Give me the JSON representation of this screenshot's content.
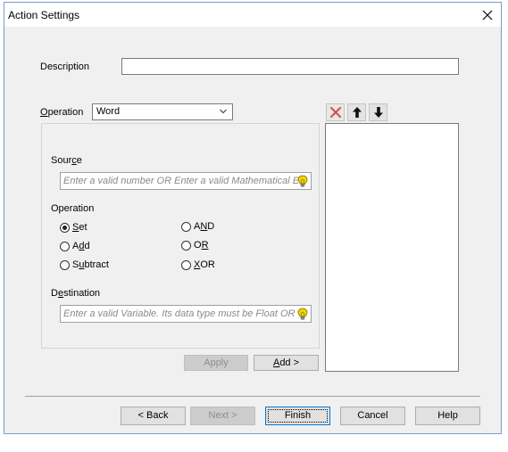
{
  "window": {
    "title": "Action Settings"
  },
  "description": {
    "label": "Description",
    "value": ""
  },
  "operation_select": {
    "label_pre": "",
    "label_ul": "O",
    "label_post": "peration",
    "value": "Word"
  },
  "source": {
    "label_pre": "Sour",
    "label_ul": "c",
    "label_post": "e",
    "placeholder": "Enter a valid number OR Enter a valid Mathematical E"
  },
  "operation_group": {
    "label": "Operation",
    "options": [
      {
        "pre": "",
        "ul": "S",
        "post": "et",
        "checked": true
      },
      {
        "pre": "A",
        "ul": "d",
        "post": "d",
        "checked": false
      },
      {
        "pre": "S",
        "ul": "u",
        "post": "btract",
        "checked": false
      },
      {
        "pre": "A",
        "ul": "N",
        "post": "D",
        "checked": false
      },
      {
        "pre": "O",
        "ul": "R",
        "post": "",
        "checked": false
      },
      {
        "pre": "",
        "ul": "X",
        "post": "OR",
        "checked": false
      }
    ]
  },
  "destination": {
    "label_pre": "D",
    "label_ul": "e",
    "label_post": "stination",
    "placeholder": "Enter a valid Variable. Its data type must be Float OR"
  },
  "buttons": {
    "apply": "Apply",
    "add_ul": "A",
    "add_post": "dd >",
    "back": "< Back",
    "next": "Next >",
    "finish": "Finish",
    "cancel": "Cancel",
    "help": "Help"
  },
  "toolbar_icons": [
    "delete-icon",
    "arrow-up-icon",
    "arrow-down-icon"
  ],
  "colors": {
    "delete_red": "#d9534f",
    "accent_blue": "#0078d7",
    "bulb_yellow": "#f5d400"
  }
}
